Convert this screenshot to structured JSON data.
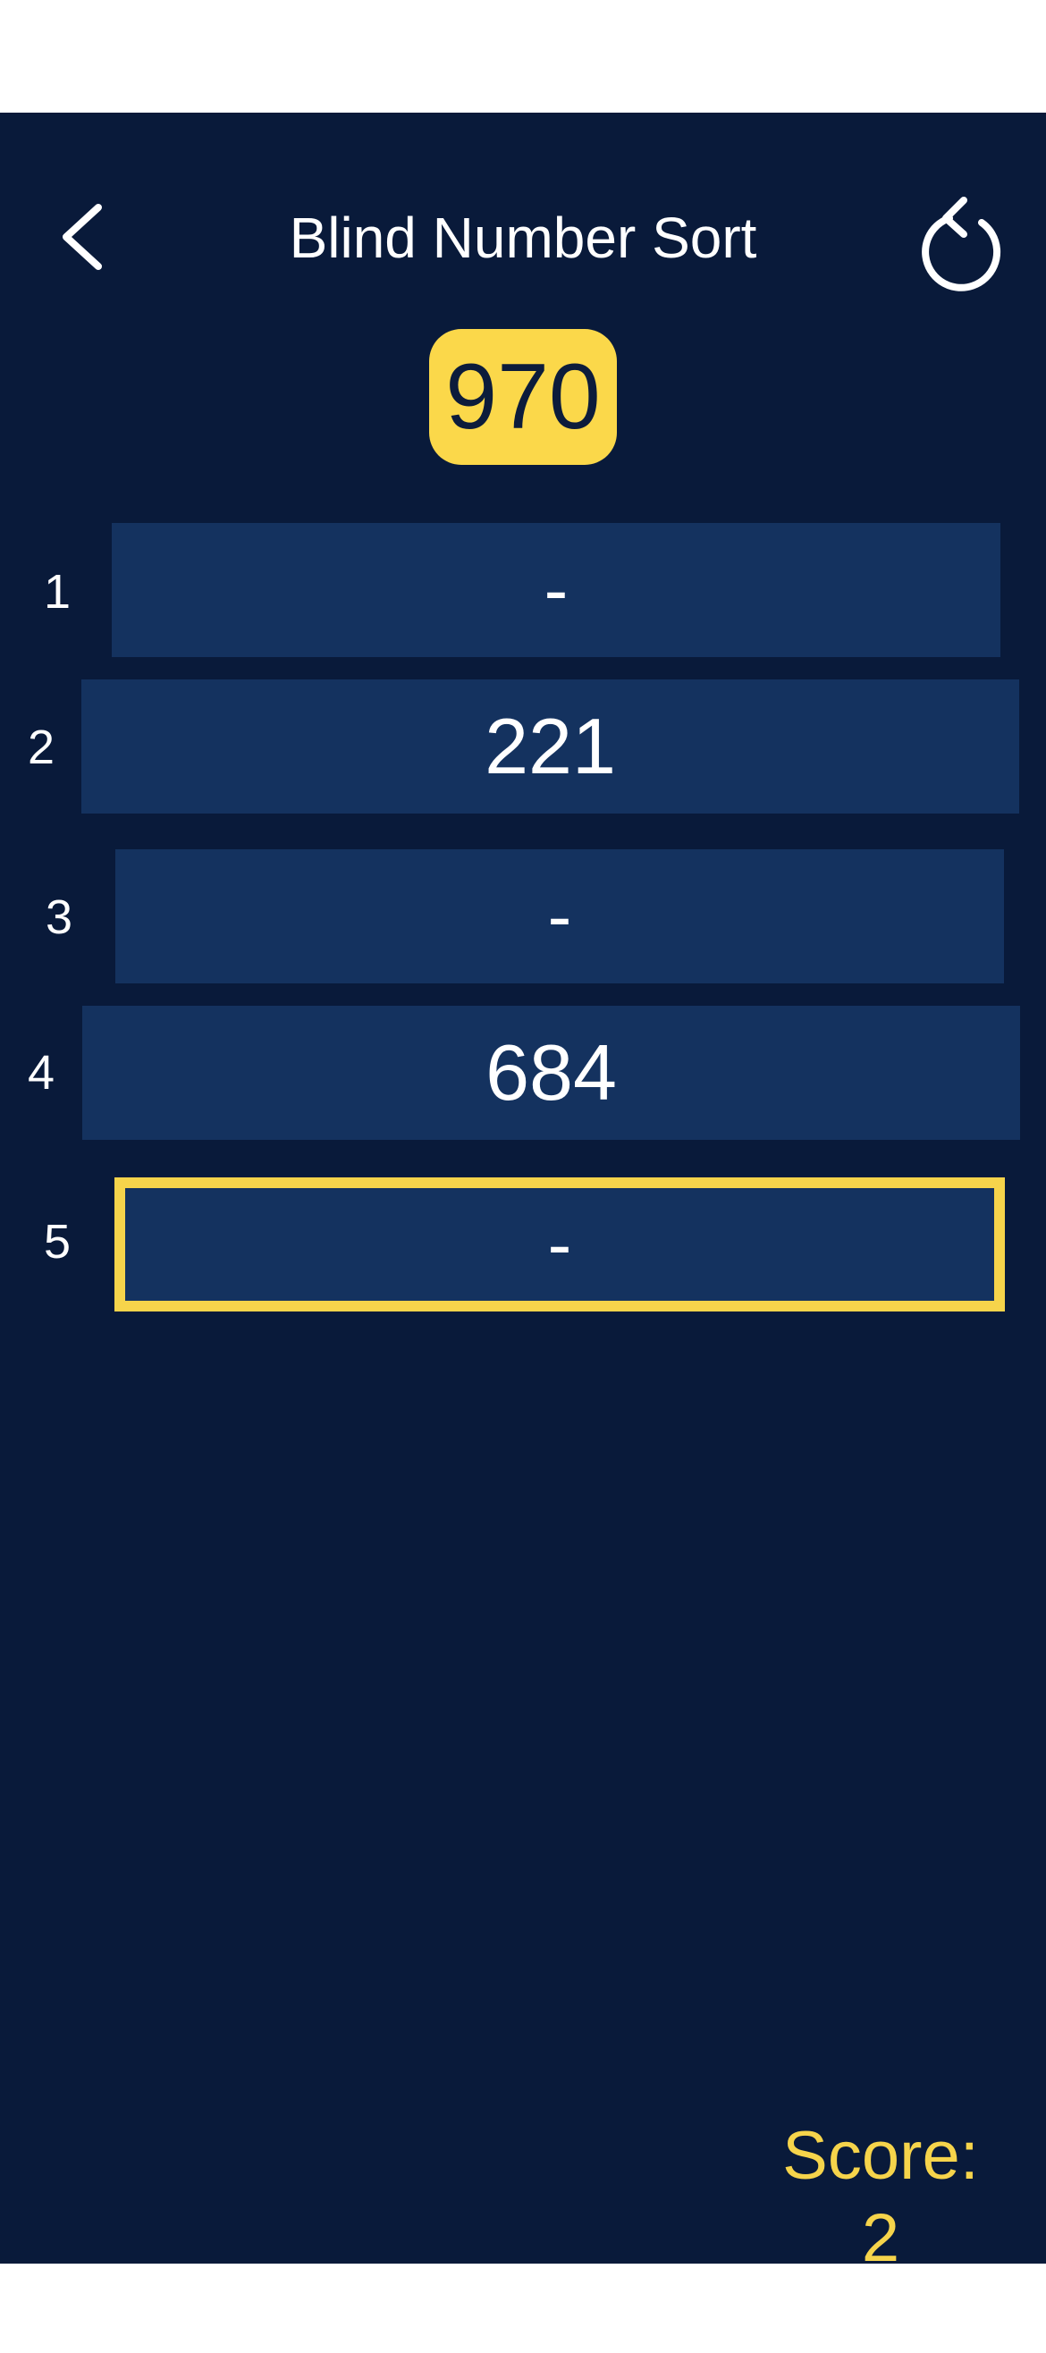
{
  "header": {
    "title": "Blind Number Sort",
    "back_icon": "chevron-left-icon",
    "reset_icon": "rotate-ccw-icon"
  },
  "current_number": "970",
  "slots": [
    {
      "index": "1",
      "value": "-"
    },
    {
      "index": "2",
      "value": "221"
    },
    {
      "index": "3",
      "value": "-"
    },
    {
      "index": "4",
      "value": "684"
    },
    {
      "index": "5",
      "value": "-"
    }
  ],
  "score": {
    "label": "Score:",
    "value": "2"
  },
  "colors": {
    "background": "#091a3a",
    "slot": "#14325f",
    "accent": "#f6d44b",
    "text": "#ffffff"
  }
}
